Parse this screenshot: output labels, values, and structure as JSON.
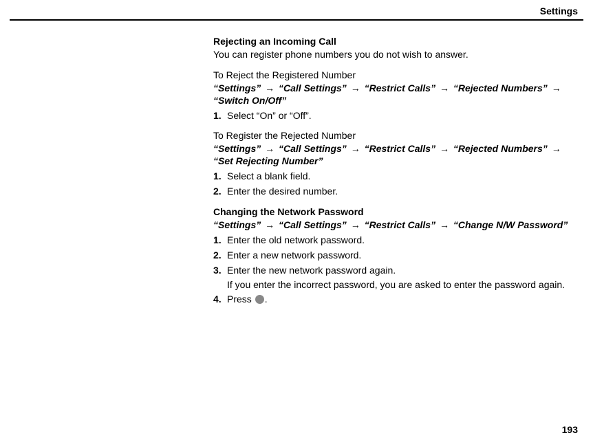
{
  "header": {
    "title": "Settings"
  },
  "footer": {
    "page_number": "193"
  },
  "s1": {
    "title": "Rejecting an Incoming Call",
    "intro": "You can register phone numbers you do not wish to answer.",
    "sub1": {
      "heading": "To Reject the Registered Number",
      "path": {
        "a": "“Settings”",
        "r1": "→",
        "b": "“Call Settings”",
        "r2": "→",
        "c": "“Restrict Calls”",
        "r3": "→",
        "d": "“Rejected Numbers”",
        "r4": "→",
        "e": "“Switch On/Off”"
      },
      "steps": {
        "n1": "1.",
        "t1": "Select “On” or “Off”."
      }
    },
    "sub2": {
      "heading": "To Register the Rejected Number",
      "path": {
        "a": "“Settings”",
        "r1": "→",
        "b": "“Call Settings”",
        "r2": "→",
        "c": "“Restrict Calls”",
        "r3": "→",
        "d": "“Rejected Numbers”",
        "r4": "→",
        "e": "“Set Rejecting Number”"
      },
      "steps": {
        "n1": "1.",
        "t1": "Select a blank field.",
        "n2": "2.",
        "t2": "Enter the desired number."
      }
    }
  },
  "s2": {
    "title": "Changing the Network Password",
    "path": {
      "a": "“Settings”",
      "r1": "→",
      "b": "“Call Settings”",
      "r2": "→",
      "c": "“Restrict Calls”",
      "r3": "→",
      "d": "“Change N/W Password”"
    },
    "steps": {
      "n1": "1.",
      "t1": "Enter the old network password.",
      "n2": "2.",
      "t2": "Enter a new network password.",
      "n3": "3.",
      "t3": "Enter the new network password again.",
      "note3": "If you enter the incorrect password, you are asked to enter the password again.",
      "n4": "4.",
      "t4a": "Press ",
      "t4b": "."
    }
  }
}
